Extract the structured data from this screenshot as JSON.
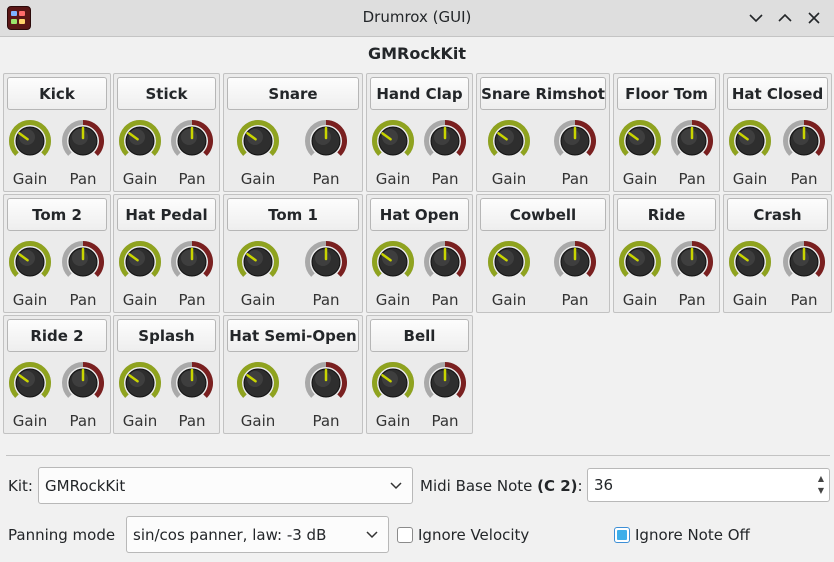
{
  "window": {
    "title": "Drumrox (GUI)"
  },
  "kit_title": "GMRockKit",
  "knob_labels": {
    "gain": "Gain",
    "pan": "Pan"
  },
  "colors": {
    "gain_arc": "#8fa31f",
    "pan_arc": "#7a2020",
    "knob_body": "#2e2e2e",
    "indicator": "#c9d500"
  },
  "instruments": [
    {
      "name": "Kick",
      "gain": 0.3,
      "pan": 0.5
    },
    {
      "name": "Stick",
      "gain": 0.3,
      "pan": 0.5
    },
    {
      "name": "Snare",
      "gain": 0.3,
      "pan": 0.5
    },
    {
      "name": "Hand Clap",
      "gain": 0.3,
      "pan": 0.5
    },
    {
      "name": "Snare Rimshot",
      "gain": 0.3,
      "pan": 0.5
    },
    {
      "name": "Floor Tom",
      "gain": 0.3,
      "pan": 0.5
    },
    {
      "name": "Hat Closed",
      "gain": 0.3,
      "pan": 0.5
    },
    {
      "name": "Tom 2",
      "gain": 0.3,
      "pan": 0.5
    },
    {
      "name": "Hat Pedal",
      "gain": 0.3,
      "pan": 0.5
    },
    {
      "name": "Tom 1",
      "gain": 0.3,
      "pan": 0.5
    },
    {
      "name": "Hat Open",
      "gain": 0.3,
      "pan": 0.5
    },
    {
      "name": "Cowbell",
      "gain": 0.3,
      "pan": 0.5
    },
    {
      "name": "Ride",
      "gain": 0.3,
      "pan": 0.5
    },
    {
      "name": "Crash",
      "gain": 0.3,
      "pan": 0.5
    },
    {
      "name": "Ride 2",
      "gain": 0.3,
      "pan": 0.5
    },
    {
      "name": "Splash",
      "gain": 0.3,
      "pan": 0.5
    },
    {
      "name": "Hat Semi-Open",
      "gain": 0.3,
      "pan": 0.5
    },
    {
      "name": "Bell",
      "gain": 0.3,
      "pan": 0.5
    }
  ],
  "controls": {
    "kit_label": "Kit:",
    "kit_value": "GMRockKit",
    "midi_label": "Midi Base Note ",
    "midi_note": "(C 2)",
    "midi_colon": ":",
    "midi_value": "36",
    "panning_label": "Panning mode",
    "panning_value": "sin/cos panner, law: -3 dB",
    "ignore_velocity": {
      "label": "Ignore Velocity",
      "checked": false
    },
    "ignore_note_off": {
      "label": "Ignore Note Off",
      "checked": true
    }
  }
}
